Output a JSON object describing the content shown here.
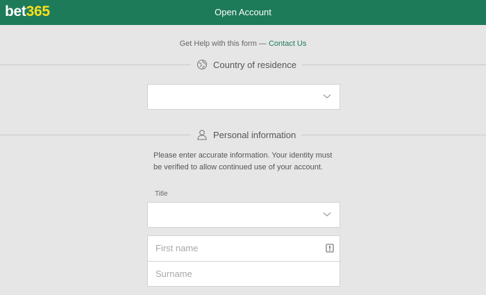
{
  "header": {
    "logo_bet": "bet",
    "logo_num": "365",
    "title": "Open Account",
    "color": "#1d7b5a",
    "logo_accent": "#ffdf1b"
  },
  "help": {
    "text": "Get Help with this form — ",
    "link": "Contact Us"
  },
  "sections": {
    "country": {
      "icon": "globe-icon",
      "title": "Country of residence",
      "select_value": ""
    },
    "personal": {
      "icon": "person-icon",
      "title": "Personal information",
      "description": "Please enter accurate information. Your identity must be verified to allow continued use of your account.",
      "title_label": "Title",
      "title_value": "",
      "first_name_placeholder": "First name",
      "surname_placeholder": "Surname"
    }
  }
}
